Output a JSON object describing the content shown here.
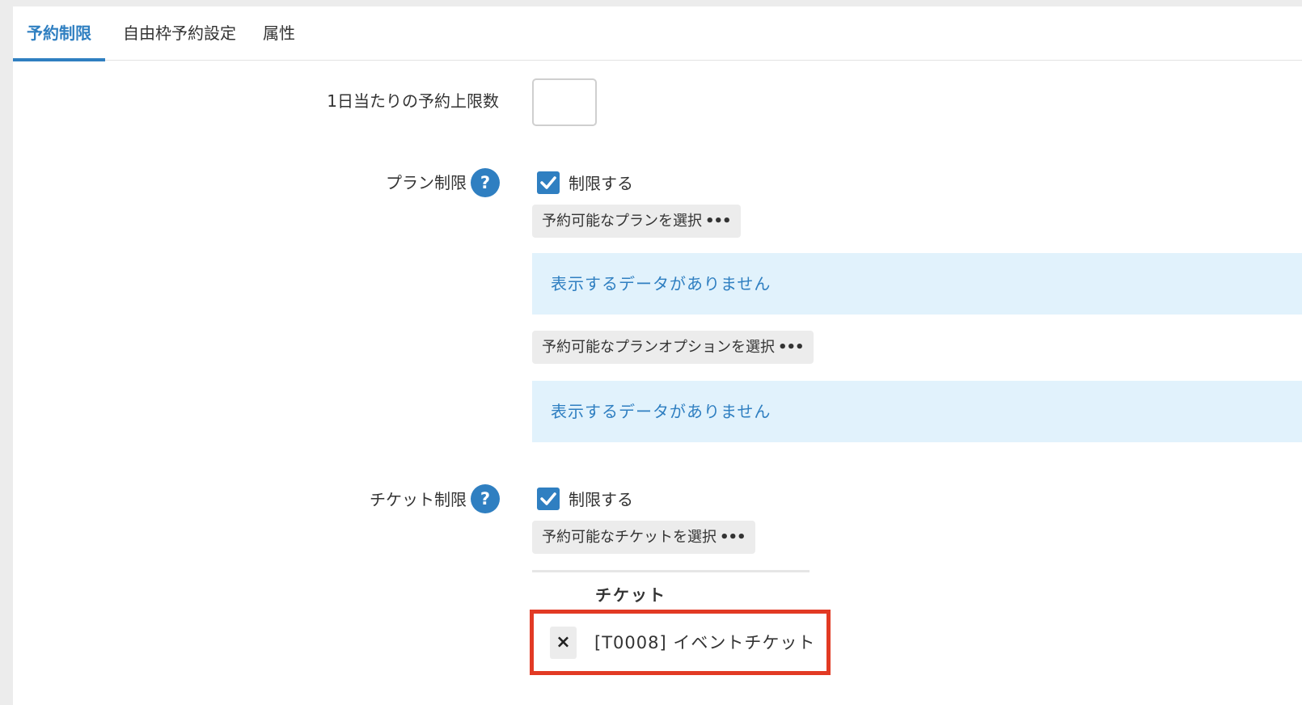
{
  "tabs": [
    {
      "label": "予約制限",
      "active": true
    },
    {
      "label": "自由枠予約設定",
      "active": false
    },
    {
      "label": "属性",
      "active": false
    }
  ],
  "form": {
    "daily_limit": {
      "label": "1日当たりの予約上限数",
      "value": ""
    },
    "plan_restriction": {
      "label": "プラン制限",
      "help": "?",
      "checkbox_label": "制限する",
      "checked": true,
      "select_plan_label": "予約可能なプランを選択",
      "plan_empty_message": "表示するデータがありません",
      "select_option_label": "予約可能なプランオプションを選択",
      "option_empty_message": "表示するデータがありません"
    },
    "ticket_restriction": {
      "label": "チケット制限",
      "help": "?",
      "checkbox_label": "制限する",
      "checked": true,
      "select_ticket_label": "予約可能なチケットを選択",
      "table_header": "チケット",
      "rows": [
        {
          "remove": "×",
          "name": "[T0008] イベントチケット"
        }
      ]
    }
  },
  "select_suffix": "•••",
  "colors": {
    "accent": "#2f7fc1",
    "info_bg": "#e1f2fc",
    "highlight": "#e23a24"
  }
}
